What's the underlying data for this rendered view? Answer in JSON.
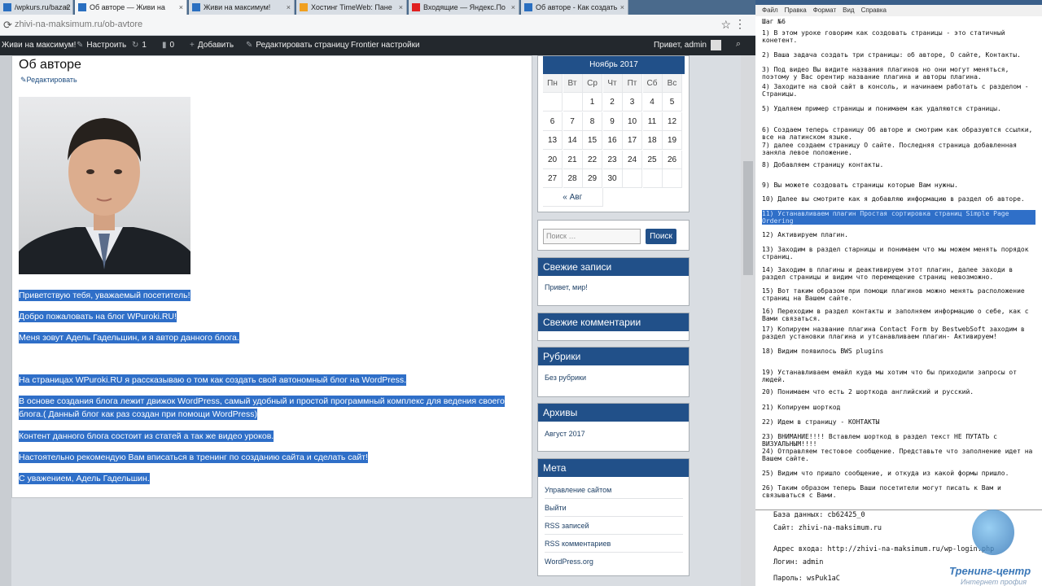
{
  "browser": {
    "tabs": [
      {
        "label": "/wpkurs.ru/baza2",
        "active": false
      },
      {
        "label": "Об авторе — Живи на",
        "active": true
      },
      {
        "label": "Живи на максимум!",
        "active": false
      },
      {
        "label": "Хостинг TimeWeb: Пане",
        "active": false
      },
      {
        "label": "Входящие — Яндекс.По",
        "active": false
      },
      {
        "label": "Об авторе - Как создать",
        "active": false
      }
    ],
    "url_host": "zhivi-na-maksimum.ru",
    "url_path": "/ob-avtore"
  },
  "wp_admin_bar": {
    "site": "Живи на максимум!",
    "customize": "Настроить",
    "updates_count": "1",
    "comments_count": "0",
    "add": "Добавить",
    "edit_page": "Редактировать страницу",
    "frontier": "Frontier настройки",
    "greeting": "Привет, admin"
  },
  "page": {
    "title": "Об авторе",
    "edit_link": "Редактировать",
    "paragraphs": [
      "Приветствую тебя,  уважаемый посетитель!",
      "Добро пожаловать на блог  WPuroki.RU!",
      "Меня зовут Адель  Гадельшин, и я автор  данного блога.",
      " ",
      "На страницах WPuroki.RU я  рассказываю о том как создать свой автономный блог на WordPress.",
      "В основе создания блога лежит движок WordPress, самый удобный и простой программный комплекс для ведения своего",
      "блога.( Данный блог как раз создан при помощи WordPress)",
      "Контент данного блога состоит из статей а так же видео уроков.",
      "Настоятельно рекомендую Вам вписаться в тренинг по созданию сайта и сделать сайт!",
      "С уважением, Адель Гадельшин."
    ]
  },
  "calendar": {
    "month": "Ноябрь 2017",
    "weekdays": [
      "Пн",
      "Вт",
      "Ср",
      "Чт",
      "Пт",
      "Сб",
      "Вс"
    ],
    "rows": [
      [
        "",
        "",
        "1",
        "2",
        "3",
        "4",
        "5"
      ],
      [
        "6",
        "7",
        "8",
        "9",
        "10",
        "11",
        "12"
      ],
      [
        "13",
        "14",
        "15",
        "16",
        "17",
        "18",
        "19"
      ],
      [
        "20",
        "21",
        "22",
        "23",
        "24",
        "25",
        "26"
      ],
      [
        "27",
        "28",
        "29",
        "30",
        "",
        "",
        ""
      ]
    ],
    "prev": "« Авг"
  },
  "search": {
    "placeholder": "Поиск …",
    "button": "Поиск"
  },
  "widgets": {
    "recent_posts": {
      "title": "Свежие записи",
      "items": [
        "Привет, мир!"
      ]
    },
    "recent_comments": {
      "title": "Свежие комментарии"
    },
    "categories": {
      "title": "Рубрики",
      "items": [
        "Без рубрики"
      ]
    },
    "archives": {
      "title": "Архивы",
      "items": [
        "Август 2017"
      ]
    },
    "meta": {
      "title": "Мета",
      "items": [
        "Управление сайтом",
        "Выйти",
        "RSS записей",
        "RSS комментариев",
        "WordPress.org"
      ]
    }
  },
  "notepad": {
    "menu": [
      "Файл",
      "Правка",
      "Формат",
      "Вид",
      "Справка"
    ],
    "heading": "Шаг №6",
    "lines": [
      "1) В этом уроке говорим как создовать страницы - это статичный\nконетент.",
      "2) Ваша задача создать три страницы: об авторе, О сайте, Контакты.",
      "3) Под видео Вы видите названия плагинов но они могут меняться,\nпоэтому у Вас орентир название плагина и авторы плагина.",
      "4) Заходите на свой сайт в консоль, и начинаем работать с разделом -\nСтраницы.",
      "5) Удаляем пример страницы и понимаем как удаляются страницы.",
      "6) Создаем теперь страницу Об авторе и смотрим как образуются ссылки,\nвсе на латинском языке.",
      "7) далее создаем страницу О сайте. Последняя страница добавленная\nзаняла левое положение.",
      "8) Добавляем страницу контакты.",
      "9) Вы можете создовать страницы которые Вам нужны.",
      "10) Далее вы смотрите как я добавляю информацию в раздел об авторе.",
      "11) Устанавливаем плагин Простая сортировка страниц Simple Page\nOrdering",
      "12) Активируем плагин.",
      "13) Заходим в раздел старницы и понимаем что мы можем менять порядок\nстраниц.",
      "14) Заходим в плагины и деактивируем этот плагин, далее заходи в\nраздел страницы и видим что перемещение страниц невозможно.",
      "15) Вот таким образом при помощи плагинов можно менять расположение\nстраниц на Вашем сайте.",
      "16) Переходим в раздел контакты и заполняем информацию о себе, как с\nВами связаться.",
      "17) Копируем название плагина Contact Form by BestwebSoft заходим в\nраздел установки плагина и утсанавливаем плагин- Активируем!",
      "18) Видим появилось BWS plugins",
      "19) Устанавливаем емайл куда мы хотим что бы приходили запросы от\nлюдей.",
      "20) Понимаем что есть 2 шорткода английский и русский.",
      "21) Копируем шорткод",
      "22) Идем в страницу - КОНТАКТЫ",
      "23) ВНИМАНИЕ!!!! Вставлем шорткод в раздел текст НЕ ПУТАТЬ с\nВИЗУАЛЬНЫМ!!!!",
      "24) Отправляем тестовое сообщение. Представьте что заполнение идет на\nВашем сайте.",
      "25) Видим что пришло сообщение, и откуда из какой формы пришло.",
      "26) Таким образом теперь Ваши посетители могут писать к Вам и\nсвязываться с Вами."
    ],
    "highlighted_index": 10,
    "lower": [
      "База данных: cb62425_0",
      "Сайт: zhivi-na-maksimum.ru",
      "Адрес входа: http://zhivi-na-maksimum.ru/wp-login.php",
      "Логин: admin",
      "Пароль: wsPuk1aC"
    ]
  },
  "logo": {
    "line1": "Тренинг-центр",
    "line2": "Интернет профия"
  }
}
